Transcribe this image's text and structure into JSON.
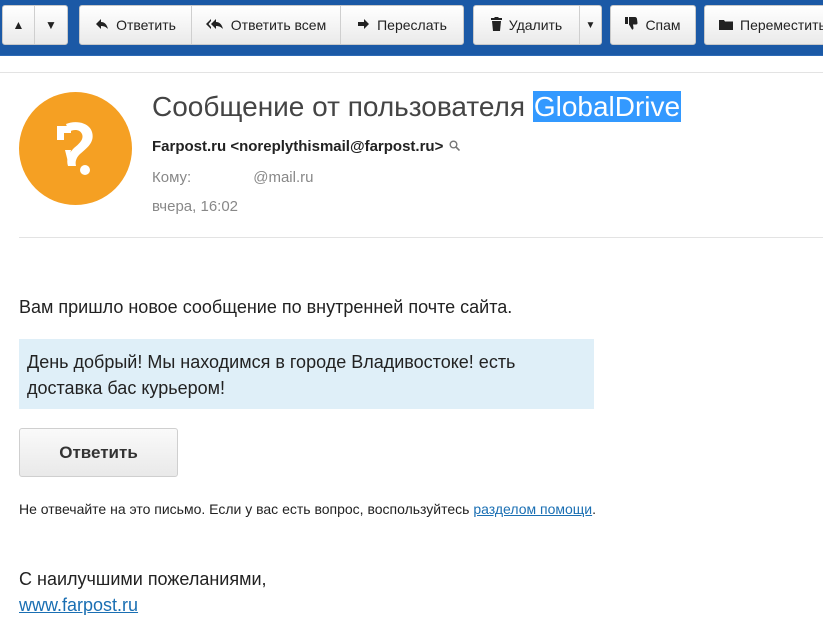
{
  "toolbar": {
    "nav_up": "▲",
    "nav_down": "▼",
    "reply": "Ответить",
    "reply_all": "Ответить всем",
    "forward": "Переслать",
    "delete": "Удалить",
    "delete_dropdown": "▼",
    "spam": "Спам",
    "move": "Переместить"
  },
  "message": {
    "subject_prefix": "Сообщение от пользователя ",
    "subject_highlight": "GlobalDrive",
    "from": "Farpost.ru <noreplythismail@farpost.ru>",
    "to_label": "Кому:",
    "to_address": "@mail.ru",
    "date": "вчера, 16:02"
  },
  "body": {
    "intro": "Вам пришло новое сообщение по внутренней почте сайта.",
    "quote": "День добрый! Мы находимся в городе Владивостоке! есть доставка бас курьером!",
    "reply_button": "Ответить",
    "notice_text": "Не отвечайте на это письмо. Если у вас есть вопрос, воспользуйтесь ",
    "notice_link": "разделом помощи",
    "notice_end": ".",
    "regards": "С наилучшими пожеланиями,",
    "site_link": "www.farpost.ru"
  },
  "colors": {
    "toolbar_bg": "#1b59a6",
    "avatar": "#f5a023",
    "highlight": "#3399ff",
    "quote_bg": "#dfeff8",
    "link": "#1a6fb3"
  }
}
